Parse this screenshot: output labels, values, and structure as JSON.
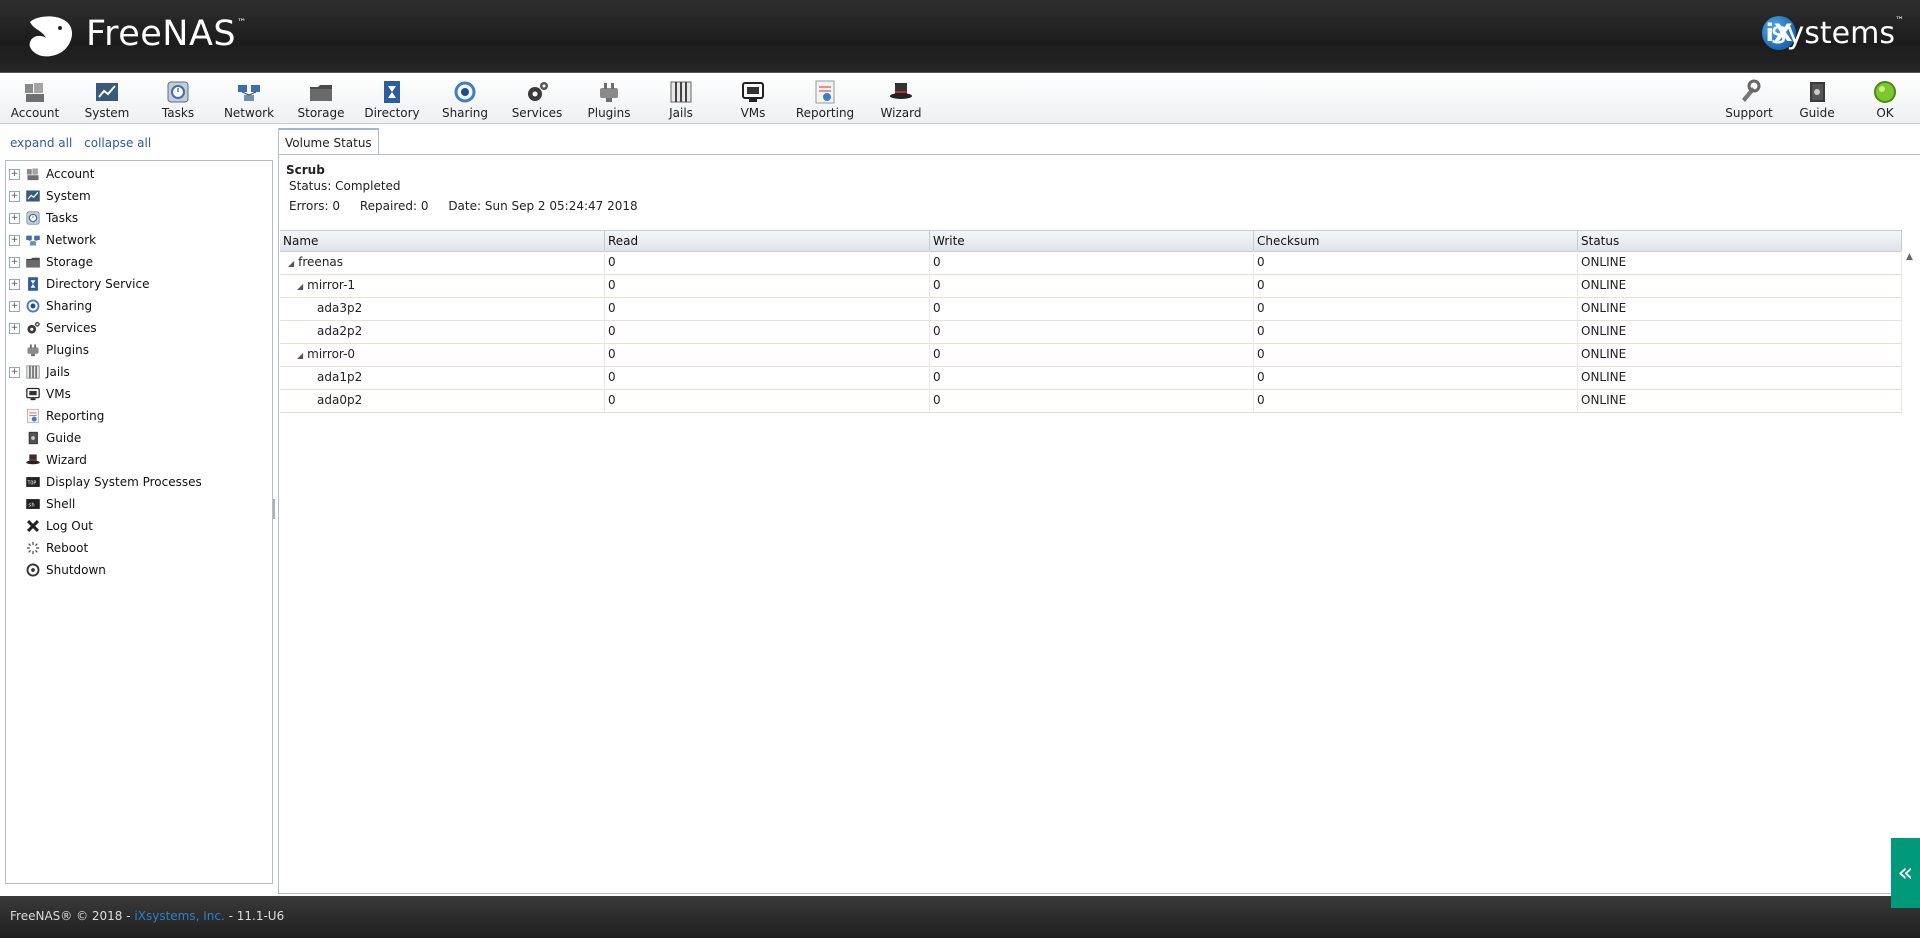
{
  "brand": {
    "product": "FreeNAS",
    "trademark": "™",
    "vendor_ix": "iX",
    "vendor_systems": "systems",
    "vendor_trademark": "™"
  },
  "toolbar": {
    "left": [
      {
        "label": "Account",
        "icon": "account-icon"
      },
      {
        "label": "System",
        "icon": "system-icon"
      },
      {
        "label": "Tasks",
        "icon": "tasks-icon"
      },
      {
        "label": "Network",
        "icon": "network-icon"
      },
      {
        "label": "Storage",
        "icon": "storage-icon"
      },
      {
        "label": "Directory",
        "icon": "directory-icon"
      },
      {
        "label": "Sharing",
        "icon": "sharing-icon"
      },
      {
        "label": "Services",
        "icon": "services-icon"
      },
      {
        "label": "Plugins",
        "icon": "plugins-icon"
      },
      {
        "label": "Jails",
        "icon": "jails-icon"
      },
      {
        "label": "VMs",
        "icon": "vms-icon"
      },
      {
        "label": "Reporting",
        "icon": "reporting-icon"
      },
      {
        "label": "Wizard",
        "icon": "wizard-icon"
      }
    ],
    "right": [
      {
        "label": "Support",
        "icon": "support-icon"
      },
      {
        "label": "Guide",
        "icon": "guide-icon"
      },
      {
        "label": "OK",
        "icon": "ok-status-icon"
      }
    ]
  },
  "tree": {
    "expand_all": "expand all",
    "collapse_all": "collapse all",
    "items": [
      {
        "label": "Account",
        "expandable": true,
        "icon": "account-icon"
      },
      {
        "label": "System",
        "expandable": true,
        "icon": "system-icon"
      },
      {
        "label": "Tasks",
        "expandable": true,
        "icon": "tasks-icon"
      },
      {
        "label": "Network",
        "expandable": true,
        "icon": "network-icon"
      },
      {
        "label": "Storage",
        "expandable": true,
        "icon": "storage-icon"
      },
      {
        "label": "Directory Service",
        "expandable": true,
        "icon": "directory-icon"
      },
      {
        "label": "Sharing",
        "expandable": true,
        "icon": "sharing-icon"
      },
      {
        "label": "Services",
        "expandable": true,
        "icon": "services-icon"
      },
      {
        "label": "Plugins",
        "expandable": false,
        "icon": "plugins-icon"
      },
      {
        "label": "Jails",
        "expandable": true,
        "icon": "jails-icon"
      },
      {
        "label": "VMs",
        "expandable": false,
        "icon": "vms-icon"
      },
      {
        "label": "Reporting",
        "expandable": false,
        "icon": "reporting-icon"
      },
      {
        "label": "Guide",
        "expandable": false,
        "icon": "guide-icon"
      },
      {
        "label": "Wizard",
        "expandable": false,
        "icon": "wizard-icon"
      },
      {
        "label": "Display System Processes",
        "expandable": false,
        "icon": "processes-icon"
      },
      {
        "label": "Shell",
        "expandable": false,
        "icon": "shell-icon"
      },
      {
        "label": "Log Out",
        "expandable": false,
        "icon": "logout-icon"
      },
      {
        "label": "Reboot",
        "expandable": false,
        "icon": "reboot-icon"
      },
      {
        "label": "Shutdown",
        "expandable": false,
        "icon": "shutdown-icon"
      }
    ]
  },
  "tab": {
    "label": "Volume Status"
  },
  "scrub": {
    "title": "Scrub",
    "status": "Status: Completed",
    "errors": "Errors: 0",
    "repaired": "Repaired: 0",
    "date": "Date: Sun Sep 2 05:24:47 2018"
  },
  "grid": {
    "columns": [
      "Name",
      "Read",
      "Write",
      "Checksum",
      "Status"
    ],
    "rows": [
      {
        "name": "freenas",
        "level": 0,
        "expanded": true,
        "read": "0",
        "write": "0",
        "checksum": "0",
        "status": "ONLINE"
      },
      {
        "name": "mirror-1",
        "level": 1,
        "expanded": true,
        "read": "0",
        "write": "0",
        "checksum": "0",
        "status": "ONLINE"
      },
      {
        "name": "ada3p2",
        "level": 2,
        "expanded": false,
        "read": "0",
        "write": "0",
        "checksum": "0",
        "status": "ONLINE"
      },
      {
        "name": "ada2p2",
        "level": 2,
        "expanded": false,
        "read": "0",
        "write": "0",
        "checksum": "0",
        "status": "ONLINE"
      },
      {
        "name": "mirror-0",
        "level": 1,
        "expanded": true,
        "read": "0",
        "write": "0",
        "checksum": "0",
        "status": "ONLINE"
      },
      {
        "name": "ada1p2",
        "level": 2,
        "expanded": false,
        "read": "0",
        "write": "0",
        "checksum": "0",
        "status": "ONLINE"
      },
      {
        "name": "ada0p2",
        "level": 2,
        "expanded": false,
        "read": "0",
        "write": "0",
        "checksum": "0",
        "status": "ONLINE"
      }
    ]
  },
  "footer": {
    "prefix": "FreeNAS® © 2018 - ",
    "link": "iXsystems, Inc.",
    "suffix": " - 11.1-U6"
  },
  "collapse_tab": {
    "glyph": "«"
  }
}
